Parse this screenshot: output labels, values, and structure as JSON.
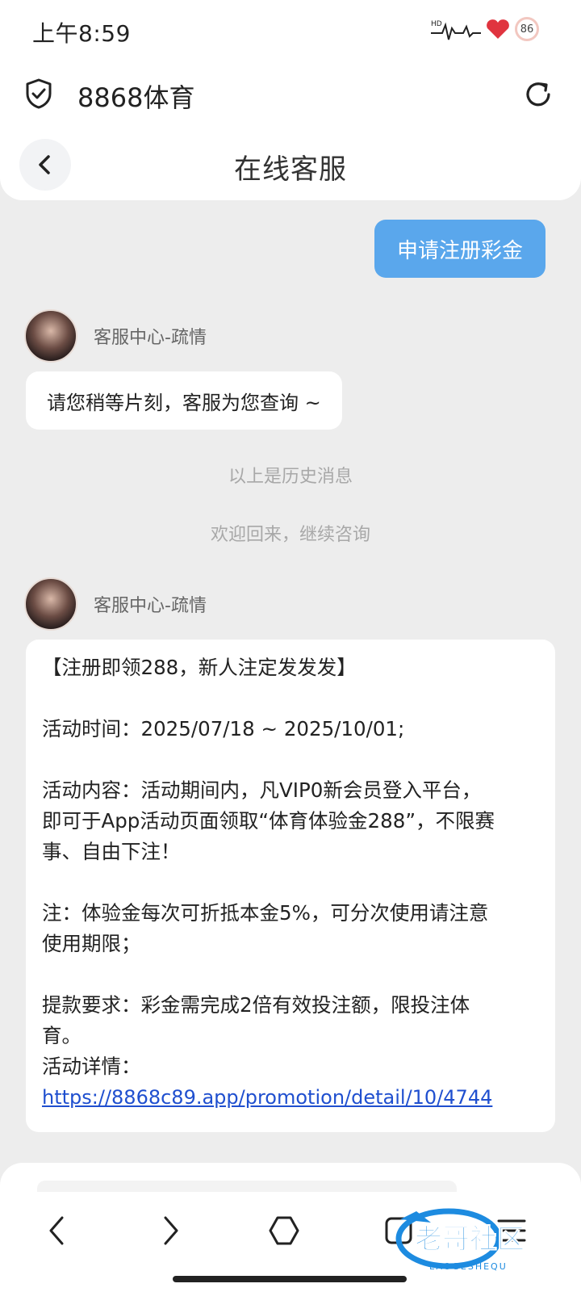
{
  "status_bar": {
    "time": "上午8:59",
    "battery": "86",
    "icons": [
      "hd-signal-icon",
      "heartbeat-icon",
      "heart-icon",
      "battery-icon"
    ]
  },
  "browser": {
    "site_title": "8868体育",
    "icons": [
      "shield-check-icon",
      "reload-icon"
    ]
  },
  "chat_header": {
    "title": "在线客服",
    "back_icon": "chevron-left-icon"
  },
  "messages": {
    "user_message": "申请注册彩金",
    "agent_name": "客服中心-疏情",
    "agent_reply_1": "请您稍等片刻，客服为您查询 ~",
    "history_note": "以上是历史消息",
    "welcome_note": "欢迎回来，继续咨询",
    "promo": {
      "headline": "【注册即领288，新人注定发发发】",
      "time_line": "活动时间：2025/07/18 ~ 2025/10/01;",
      "content_line_1": "活动内容：活动期间内，凡VIP0新会员登入平台，",
      "content_line_2": "即可于App活动页面领取“体育体验金288”，不限赛",
      "content_line_3": "事、自由下注！",
      "note_line_1": "注：体验金每次可折抵本金5%，可分次使用请注意",
      "note_line_2": "使用期限；",
      "withdraw_line_1": "提款要求：彩金需完成2倍有效投注额，限投注体",
      "withdraw_line_2": "育。",
      "details_label": "活动详情：",
      "details_link": "https://8868c89.app/promotion/detail/10/4744"
    }
  },
  "bottom_nav": {
    "icons": [
      "back-arrow-icon",
      "forward-arrow-icon",
      "home-icon",
      "tabs-icon",
      "menu-icon"
    ]
  },
  "watermark": {
    "text": "老哥社区",
    "subtext": "LAOGESHEQU"
  },
  "colors": {
    "user_bubble": "#5aa7ec",
    "page_bg": "#ededed",
    "link": "#1f4fcf"
  }
}
